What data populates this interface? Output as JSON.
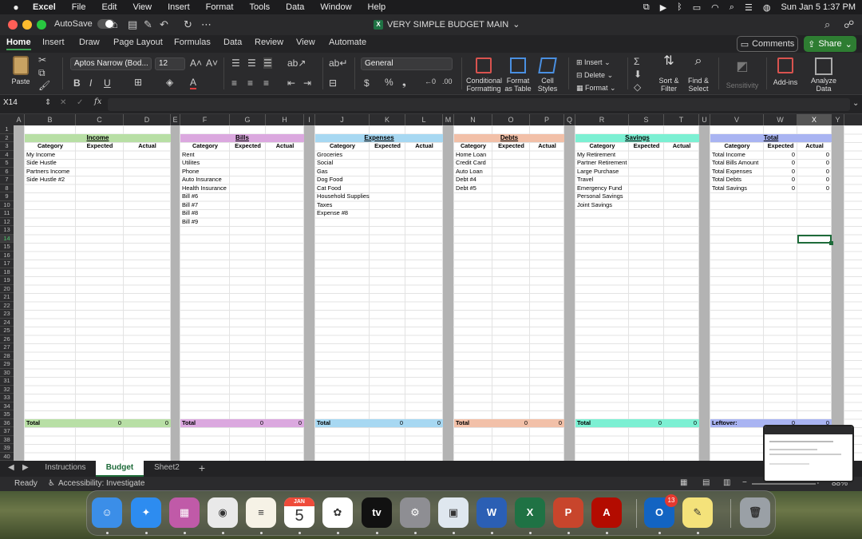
{
  "menubar": {
    "app": "Excel",
    "items": [
      "File",
      "Edit",
      "View",
      "Insert",
      "Format",
      "Tools",
      "Data",
      "Window",
      "Help"
    ],
    "datetime": "Sun Jan 5  1:37 PM"
  },
  "titlebar": {
    "autosave": "AutoSave",
    "doc_title": "VERY SIMPLE BUDGET MAIN",
    "autosave_state": "off"
  },
  "ribbon_tabs": [
    "Home",
    "Insert",
    "Draw",
    "Page Layout",
    "Formulas",
    "Data",
    "Review",
    "View",
    "Automate"
  ],
  "ribbon_buttons": {
    "comments": "Comments",
    "share": "Share",
    "paste": "Paste",
    "font_name": "Aptos Narrow (Bod...",
    "font_size": "12",
    "number_format": "General",
    "insert": "Insert",
    "delete": "Delete",
    "format": "Format",
    "conditional_formatting_1": "Conditional",
    "conditional_formatting_2": "Formatting",
    "format_as_table_1": "Format",
    "format_as_table_2": "as Table",
    "cell_styles_1": "Cell",
    "cell_styles_2": "Styles",
    "sort_filter_1": "Sort &",
    "sort_filter_2": "Filter",
    "find_select_1": "Find &",
    "find_select_2": "Select",
    "sensitivity": "Sensitivity",
    "addins": "Add-ins",
    "analyze_1": "Analyze",
    "analyze_2": "Data"
  },
  "formula_bar": {
    "name_box": "X14",
    "fx": "fx",
    "formula": ""
  },
  "columns": [
    "A",
    "B",
    "C",
    "D",
    "E",
    "F",
    "G",
    "H",
    "I",
    "J",
    "K",
    "L",
    "M",
    "N",
    "O",
    "P",
    "Q",
    "R",
    "S",
    "T",
    "U",
    "V",
    "W",
    "X",
    "Y"
  ],
  "selected_column": "X",
  "rows": [
    "1",
    "2",
    "3",
    "4",
    "5",
    "6",
    "7",
    "8",
    "9",
    "10",
    "11",
    "12",
    "13",
    "14",
    "15",
    "16",
    "17",
    "18",
    "19",
    "20",
    "21",
    "22",
    "23",
    "24",
    "25",
    "26",
    "27",
    "28",
    "29",
    "30",
    "31",
    "32",
    "33",
    "34",
    "35",
    "36",
    "37",
    "38",
    "39",
    "40"
  ],
  "selected_row": "14",
  "sub_headers": {
    "category": "Category",
    "expected": "Expected",
    "actual": "Actual"
  },
  "sections": [
    {
      "title": "Income",
      "color": "#b8dfa5",
      "items": [
        "My Income",
        "Side Hustle",
        "Partners Income",
        "Side Hustle #2"
      ],
      "total_label": "Total",
      "total_expected": "0",
      "total_actual": "0"
    },
    {
      "title": "Bills",
      "color": "#dba8df",
      "items": [
        "Rent",
        "Utilites",
        "Phone",
        "Auto Insurance",
        "Health Insurance",
        "Bill #6",
        "Bill #7",
        "Bill #8",
        "Bill #9"
      ],
      "total_label": "Total",
      "total_expected": "0",
      "total_actual": "0"
    },
    {
      "title": "Expenses",
      "color": "#a7d8f2",
      "items": [
        "Groceries",
        "Social",
        "Gas",
        "Dog Food",
        "Cat Food",
        "Household Supplies",
        "Taxes",
        "Expense #8"
      ],
      "total_label": "Total",
      "total_expected": "0",
      "total_actual": "0"
    },
    {
      "title": "Debts",
      "color": "#f2c0a8",
      "items": [
        "Home Loan",
        "Credit Card",
        "Auto Loan",
        "Debt #4",
        "Debt #5"
      ],
      "total_label": "Total",
      "total_expected": "0",
      "total_actual": "0"
    },
    {
      "title": "Savings",
      "color": "#7cf0d3",
      "items": [
        "My Retirement",
        "Partner Retirement",
        "Large Purchase",
        "Travel",
        "Emergency Fund",
        "Personal Savings",
        "Joint Savings"
      ],
      "total_label": "Total",
      "total_expected": "0",
      "total_actual": "0"
    },
    {
      "title": "Total",
      "color": "#a9b4f2",
      "items": [
        "Total Income",
        "Total Bills Amount",
        "Total Expenses",
        "Total Debts",
        "Total Savings"
      ],
      "item_expected": [
        "0",
        "0",
        "0",
        "0",
        "0"
      ],
      "item_actual": [
        "0",
        "0",
        "0",
        "0",
        "0"
      ],
      "total_label": "Leftover:",
      "total_expected": "0",
      "total_actual": "0"
    }
  ],
  "sheet_tabs": [
    "Instructions",
    "Budget",
    "Sheet2"
  ],
  "active_sheet": "Budget",
  "add_sheet": "+",
  "status": {
    "ready": "Ready",
    "accessibility": "Accessibility: Investigate",
    "zoom": "88%"
  },
  "dock": [
    {
      "name": "Finder",
      "glyph": "☺",
      "color": "#3b8ee8"
    },
    {
      "name": "Safari",
      "glyph": "✦",
      "color": "#2d8cf0"
    },
    {
      "name": "Launchpad",
      "glyph": "▦",
      "color": "#c05aa8"
    },
    {
      "name": "Chrome",
      "glyph": "◉",
      "color": "#e9e9e9"
    },
    {
      "name": "Notes",
      "glyph": "≡",
      "color": "#f6f2e6"
    },
    {
      "name": "Calendar",
      "glyph": "5",
      "color": "#ffffff",
      "top_label": "JAN"
    },
    {
      "name": "Photos",
      "glyph": "✿",
      "color": "#ffffff"
    },
    {
      "name": "Apple TV",
      "glyph": "tv",
      "color": "#111111"
    },
    {
      "name": "System Settings",
      "glyph": "⚙",
      "color": "#8e8e93"
    },
    {
      "name": "Preview",
      "glyph": "▣",
      "color": "#dfe7ef"
    },
    {
      "name": "Word",
      "glyph": "W",
      "color": "#2b5fb4"
    },
    {
      "name": "Excel",
      "glyph": "X",
      "color": "#1f7244"
    },
    {
      "name": "PowerPoint",
      "glyph": "P",
      "color": "#c8452c"
    },
    {
      "name": "Acrobat",
      "glyph": "A",
      "color": "#b30b00"
    },
    {
      "name": "Outlook",
      "glyph": "O",
      "color": "#1364c2",
      "badge": "13"
    },
    {
      "name": "Stickies",
      "glyph": "✎",
      "color": "#f4e27a"
    },
    {
      "name": "Trash",
      "glyph": "🗑",
      "color": "#9aa0a6"
    }
  ]
}
